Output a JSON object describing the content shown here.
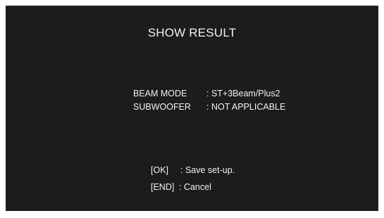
{
  "screen": {
    "title": "SHOW RESULT",
    "background_color": "#1c1c1c",
    "text_color": "#f2f2f2"
  },
  "info": {
    "beam_mode_label": "BEAM MODE",
    "beam_mode_value": ": ST+3Beam/Plus2",
    "subwoofer_label": "SUBWOOFER",
    "subwoofer_value": ": NOT APPLICABLE"
  },
  "keys": {
    "ok_key": "[OK]",
    "ok_action": ": Save set-up.",
    "end_key": "[END]",
    "end_action": ": Cancel"
  }
}
